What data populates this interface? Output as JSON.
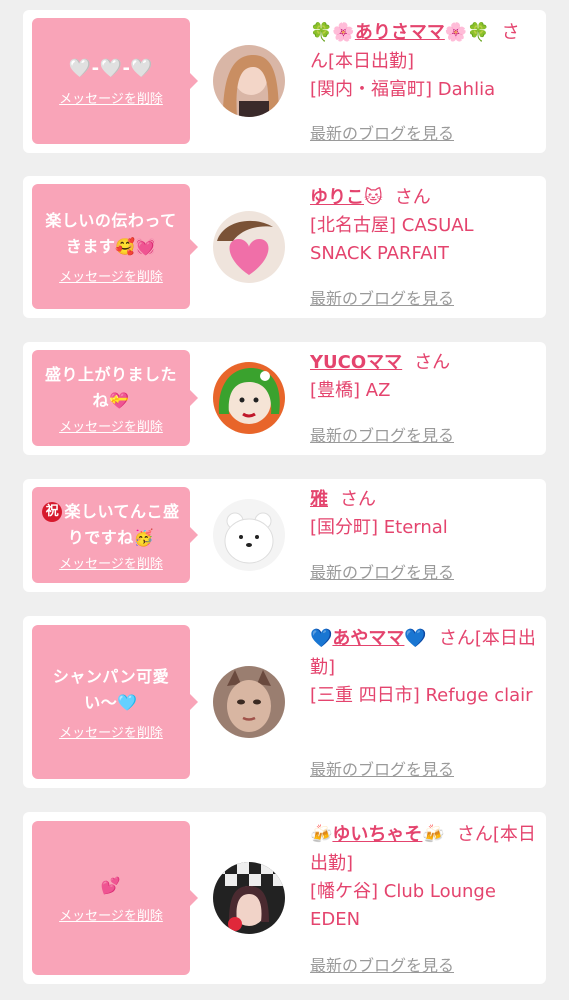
{
  "colors": {
    "page_bg": "#efefef",
    "bubble_bg": "#f9a4b8",
    "accent_text": "#e4446e",
    "muted_link": "#9a9a9a"
  },
  "delete_label": "メッセージを削除",
  "blog_label": "最新のブログを見る",
  "honorific": "さん",
  "cards": [
    {
      "message": "🤍-🤍-🤍",
      "name_prefix_icon": "🍀🌸",
      "name": "ありさママ",
      "name_suffix_icon": "🌸🍀",
      "status": "[本日出勤]",
      "shop": "[関内・福富町] Dahlia",
      "avatar": "avatar-woman-blonde-icon"
    },
    {
      "message": "楽しいの伝わってきます🥰💓",
      "name_prefix_icon": "",
      "name": "ゆりこ",
      "name_suffix_icon": "🐱",
      "status": "",
      "shop": "[北名古屋] CASUAL SNACK PARFAIT",
      "avatar": "avatar-heart-sticker-icon"
    },
    {
      "message": "盛り上がりましたね💝",
      "name_prefix_icon": "",
      "name": "YUCOママ",
      "name_suffix_icon": "",
      "status": "",
      "shop": "[豊橋] AZ",
      "avatar": "avatar-green-hair-illustration-icon"
    },
    {
      "message_badge": "祝",
      "message": "楽しいてんこ盛りですね🥳",
      "name_prefix_icon": "",
      "name": "雅",
      "name_suffix_icon": "",
      "status": "",
      "shop": "[国分町] Eternal",
      "avatar": "avatar-white-bear-plush-icon"
    },
    {
      "message": "シャンパン可愛い〜🩵",
      "name_prefix_icon": "💙",
      "name": "あやママ",
      "name_suffix_icon": "💙",
      "status": "[本日出勤]",
      "shop": "[三重 四日市] Refuge clair",
      "avatar": "avatar-woman-cat-filter-icon"
    },
    {
      "message": "💕",
      "name_prefix_icon": "🍻",
      "name": "ゆいちゃそ",
      "name_suffix_icon": "🍻",
      "status": "[本日出勤]",
      "shop": "[幡ケ谷] Club Lounge EDEN",
      "avatar": "avatar-woman-checker-bg-icon"
    }
  ]
}
